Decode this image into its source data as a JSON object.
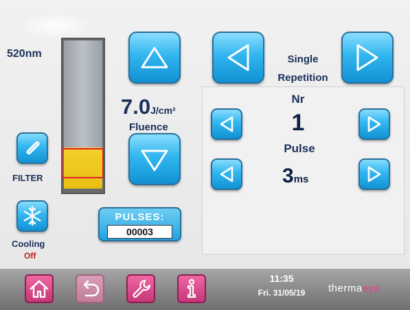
{
  "wavelength": "520nm",
  "filter_label": "FILTER",
  "cooling": {
    "label": "Cooling",
    "state": "Off"
  },
  "fluence": {
    "value": "7.0",
    "unit": "J/cm²",
    "label": "Fluence"
  },
  "mode": {
    "line1": "Single",
    "line2": "Repetition"
  },
  "nr": {
    "label": "Nr",
    "value": "1"
  },
  "pulse": {
    "label": "Pulse",
    "value": "3",
    "unit": "ms"
  },
  "pulses": {
    "label": "PULSES:",
    "value": "00003"
  },
  "clock": {
    "time": "11:35",
    "date": "Fri. 31/05/19"
  },
  "brand": {
    "part1": "therma",
    "part2": "eye"
  },
  "colors": {
    "accent_blue": "#32b6ef",
    "nav_pink": "#e04c8f",
    "selection_red": "#e21f2a",
    "cooling_off": "#c41a1a"
  }
}
